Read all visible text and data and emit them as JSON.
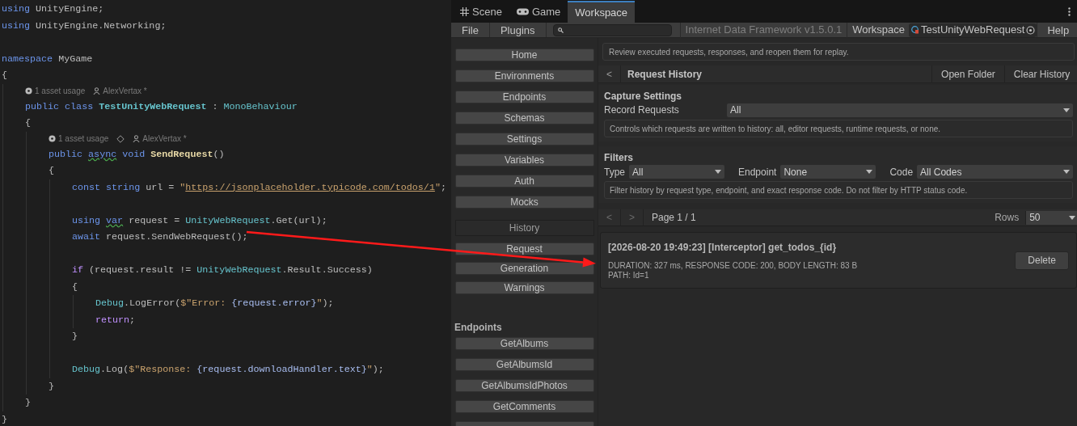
{
  "code": [
    {
      "kind": "line",
      "tokens": [
        {
          "kind": "kw",
          "text": "using"
        },
        {
          "kind": "plain",
          "text": " UnityEngine;"
        }
      ]
    },
    {
      "kind": "line",
      "tokens": [
        {
          "kind": "kw",
          "text": "using"
        },
        {
          "kind": "plain",
          "text": " UnityEngine.Networking;"
        }
      ]
    },
    {
      "kind": "blank"
    },
    {
      "kind": "line",
      "tokens": [
        {
          "kind": "kw",
          "text": "namespace"
        },
        {
          "kind": "plain",
          "text": " MyGame"
        }
      ]
    },
    {
      "kind": "line",
      "tokens": [
        {
          "kind": "plain",
          "text": "{"
        }
      ]
    },
    {
      "kind": "block",
      "children": [
        {
          "kind": "hint",
          "items": [
            {
              "kind": "usage",
              "text": "1 asset usage"
            },
            {
              "kind": "author",
              "text": "AlexVertax *"
            }
          ]
        },
        {
          "kind": "line",
          "tokens": [
            {
              "kind": "kw",
              "text": "public class "
            },
            {
              "kind": "typebold",
              "text": "TestUnityWebRequest"
            },
            {
              "kind": "plain",
              "text": " : "
            },
            {
              "kind": "type",
              "text": "MonoBehaviour"
            }
          ]
        },
        {
          "kind": "line",
          "tokens": [
            {
              "kind": "plain",
              "text": "{"
            }
          ]
        },
        {
          "kind": "block",
          "children": [
            {
              "kind": "hint",
              "items": [
                {
                  "kind": "usage",
                  "text": "1 asset usage"
                },
                {
                  "kind": "marker"
                },
                {
                  "kind": "author",
                  "text": "AlexVertax *"
                }
              ]
            },
            {
              "kind": "line",
              "tokens": [
                {
                  "kind": "kw",
                  "text": "public "
                },
                {
                  "kind": "kw_squiggle",
                  "text": "async"
                },
                {
                  "kind": "kw",
                  "text": " void "
                },
                {
                  "kind": "fn",
                  "text": "SendRequest"
                },
                {
                  "kind": "plain",
                  "text": "()"
                }
              ]
            },
            {
              "kind": "line",
              "tokens": [
                {
                  "kind": "plain",
                  "text": "{"
                }
              ]
            },
            {
              "kind": "block",
              "children": [
                {
                  "kind": "line",
                  "tokens": [
                    {
                      "kind": "kw",
                      "text": "const string"
                    },
                    {
                      "kind": "plain",
                      "text": " url = "
                    },
                    {
                      "kind": "str",
                      "text": "\""
                    },
                    {
                      "kind": "url",
                      "text": "https://jsonplaceholder.typicode.com/todos/1"
                    },
                    {
                      "kind": "str",
                      "text": "\""
                    },
                    {
                      "kind": "plain",
                      "text": ";"
                    }
                  ]
                },
                {
                  "kind": "blank"
                },
                {
                  "kind": "line",
                  "tokens": [
                    {
                      "kind": "kw",
                      "text": "using "
                    },
                    {
                      "kind": "kw_squiggle",
                      "text": "var"
                    },
                    {
                      "kind": "plain",
                      "text": " request = "
                    },
                    {
                      "kind": "type",
                      "text": "UnityWebRequest"
                    },
                    {
                      "kind": "plain",
                      "text": ".Get(url);"
                    }
                  ]
                },
                {
                  "kind": "line",
                  "tokens": [
                    {
                      "kind": "kw",
                      "text": "await"
                    },
                    {
                      "kind": "plain",
                      "text": " request.SendWebRequest();"
                    }
                  ]
                },
                {
                  "kind": "blank"
                },
                {
                  "kind": "line",
                  "tokens": [
                    {
                      "kind": "ctrl",
                      "text": "if"
                    },
                    {
                      "kind": "plain",
                      "text": " (request.result != "
                    },
                    {
                      "kind": "type",
                      "text": "UnityWebRequest"
                    },
                    {
                      "kind": "plain",
                      "text": ".Result.Success)"
                    }
                  ]
                },
                {
                  "kind": "line",
                  "tokens": [
                    {
                      "kind": "plain",
                      "text": "{"
                    }
                  ]
                },
                {
                  "kind": "block",
                  "children": [
                    {
                      "kind": "line",
                      "tokens": [
                        {
                          "kind": "type",
                          "text": "Debug"
                        },
                        {
                          "kind": "plain",
                          "text": ".LogError("
                        },
                        {
                          "kind": "str",
                          "text": "$\"Error: "
                        },
                        {
                          "kind": "interp",
                          "text": "{request.error}"
                        },
                        {
                          "kind": "str",
                          "text": "\""
                        },
                        {
                          "kind": "plain",
                          "text": ");"
                        }
                      ]
                    },
                    {
                      "kind": "line",
                      "tokens": [
                        {
                          "kind": "ctrl",
                          "text": "return"
                        },
                        {
                          "kind": "plain",
                          "text": ";"
                        }
                      ]
                    }
                  ]
                },
                {
                  "kind": "line",
                  "tokens": [
                    {
                      "kind": "plain",
                      "text": "}"
                    }
                  ]
                },
                {
                  "kind": "blank"
                },
                {
                  "kind": "line",
                  "tokens": [
                    {
                      "kind": "type",
                      "text": "Debug"
                    },
                    {
                      "kind": "plain",
                      "text": ".Log("
                    },
                    {
                      "kind": "str",
                      "text": "$\"Response: "
                    },
                    {
                      "kind": "interp",
                      "text": "{request.downloadHandler.text}"
                    },
                    {
                      "kind": "str",
                      "text": "\""
                    },
                    {
                      "kind": "plain",
                      "text": ");"
                    }
                  ]
                }
              ]
            },
            {
              "kind": "line",
              "tokens": [
                {
                  "kind": "plain",
                  "text": "}"
                }
              ]
            }
          ]
        },
        {
          "kind": "line",
          "tokens": [
            {
              "kind": "plain",
              "text": "}"
            }
          ]
        }
      ]
    },
    {
      "kind": "line",
      "tokens": [
        {
          "kind": "plain",
          "text": "}"
        }
      ]
    }
  ],
  "editor": {
    "tabs": [
      {
        "kind": "scene",
        "label": "Scene",
        "selected": false
      },
      {
        "kind": "game",
        "label": "Game",
        "selected": false
      },
      {
        "kind": "plain",
        "label": "Workspace",
        "selected": true
      }
    ],
    "toolbar": {
      "menus": [
        "File",
        "Plugins"
      ],
      "title": "Internet Data Framework v1.5.0.1",
      "workspace_label": "Workspace",
      "workspace_value": "TestUnityWebRequest",
      "help": "Help"
    },
    "sidebar": {
      "nav": [
        {
          "label": "Home",
          "selected": false
        },
        {
          "label": "Environments",
          "selected": false
        },
        {
          "label": "Endpoints",
          "selected": false
        },
        {
          "label": "Schemas",
          "selected": false
        },
        {
          "label": "Settings",
          "selected": false
        },
        {
          "label": "Variables",
          "selected": false
        },
        {
          "label": "Auth",
          "selected": false
        },
        {
          "label": "Mocks",
          "selected": false
        }
      ],
      "history": [
        {
          "label": "History",
          "selected": true
        },
        {
          "label": "Request",
          "selected": false
        },
        {
          "label": "Generation",
          "selected": false
        },
        {
          "label": "Warnings",
          "selected": false
        }
      ],
      "endpoints_title": "Endpoints",
      "endpoints": [
        "GetAlbums",
        "GetAlbumsId",
        "GetAlbumsIdPhotos",
        "GetComments"
      ]
    },
    "description": "Review executed requests, responses, and reopen them for replay.",
    "header": {
      "back": "<",
      "title": "Request History",
      "actions": [
        "Open Folder",
        "Clear History"
      ]
    },
    "capture": {
      "title": "Capture Settings",
      "label": "Record Requests",
      "value": "All",
      "help": "Controls which requests are written to history: all, editor requests, runtime requests, or none."
    },
    "filters": {
      "title": "Filters",
      "fields": [
        {
          "label": "Type",
          "value": "All"
        },
        {
          "label": "Endpoint",
          "value": "None"
        },
        {
          "label": "Code",
          "value": "All Codes"
        }
      ],
      "help": "Filter history by request type, endpoint, and exact response code. Do not filter by HTTP status code."
    },
    "pagination": {
      "prev": {
        "text": "<",
        "disabled": true
      },
      "next": {
        "text": ">",
        "disabled": true
      },
      "page": "Page 1 / 1",
      "rows_label": "Rows",
      "rows_value": "50"
    },
    "entries": [
      {
        "title": "[2026-08-20 19:49:23] [Interceptor] get_todos_{id}",
        "details": [
          "DURATION: 327 ms, RESPONSE CODE: 200, BODY LENGTH: 83 B",
          "PATH: Id=1"
        ],
        "action": "Delete"
      }
    ]
  }
}
